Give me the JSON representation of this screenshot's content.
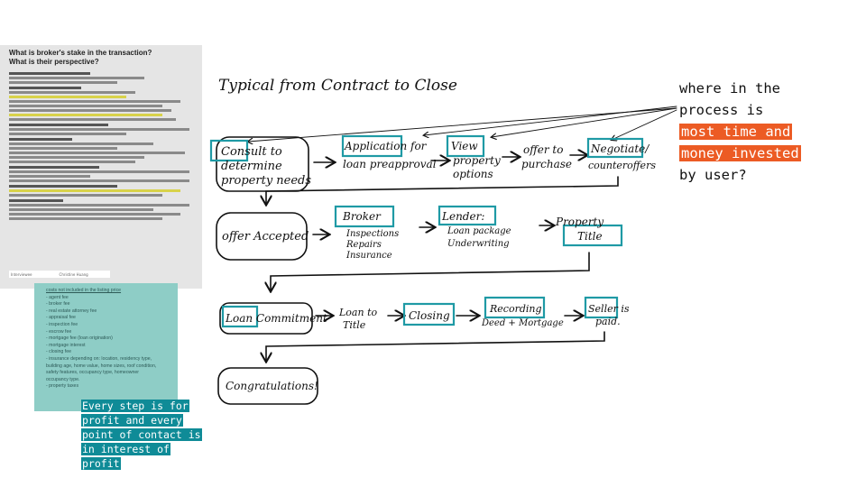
{
  "document": {
    "title_line1": "What is broker's stake in the transaction?",
    "title_line2": "What is their perspective?",
    "footer_left": "Interviewee",
    "footer_right": "Christine Huang"
  },
  "costs_note": {
    "title": "costs not included in the listing price",
    "items": [
      "- agent fee",
      "- broker fee",
      "- real estate attorney fee",
      "- appraisal fee",
      "- inspection fee",
      "- escrow fee",
      "- mortgage fee (loan origination)",
      "- mortgage interest",
      "- closing fee",
      "- insurance depending on: location, residency type,",
      "building age, home value, home sizes, roof condition,",
      "safety features, occupancy type, homeowner",
      "occupancy type.",
      "- property taxes"
    ]
  },
  "diagram": {
    "title": "Typical from Contract to Close",
    "steps": {
      "consult": [
        "Consult to",
        "determine",
        "property needs"
      ],
      "application": [
        "Application for",
        "loan preapproval"
      ],
      "view": [
        "View",
        "property",
        "options"
      ],
      "offer": [
        "offer to",
        "purchase"
      ],
      "negotiate": [
        "Negotiate/",
        "counteroffers"
      ],
      "accepted": [
        "offer Accepted"
      ],
      "broker": [
        "Broker",
        "Inspections",
        "Repairs",
        "Insurance"
      ],
      "lender": [
        "Lender:",
        "Loan package",
        "Underwriting"
      ],
      "title": [
        "Property",
        "Title"
      ],
      "commitment": [
        "Loan Commitment"
      ],
      "loan_title": [
        "Loan to",
        "Title"
      ],
      "closing": [
        "Closing"
      ],
      "recording": [
        "Recording",
        "Deed + Mortgage"
      ],
      "seller": [
        "Seller is",
        "paid."
      ],
      "congrats": [
        "Congratulations!"
      ]
    }
  },
  "notes": {
    "question_lines": [
      "where in the",
      "process is"
    ],
    "question_highlight": [
      "most time and",
      "money invested"
    ],
    "question_end": "by user?",
    "profit_lines": [
      "Every step is for",
      "profit and every",
      "point of contact is",
      "in interest of",
      "profit"
    ]
  },
  "colors": {
    "teal_box": "#1f9aa5",
    "orange_highlight": "#ec5b24",
    "teal_note": "#8ecdc6",
    "profit_highlight": "#0f8b97"
  }
}
